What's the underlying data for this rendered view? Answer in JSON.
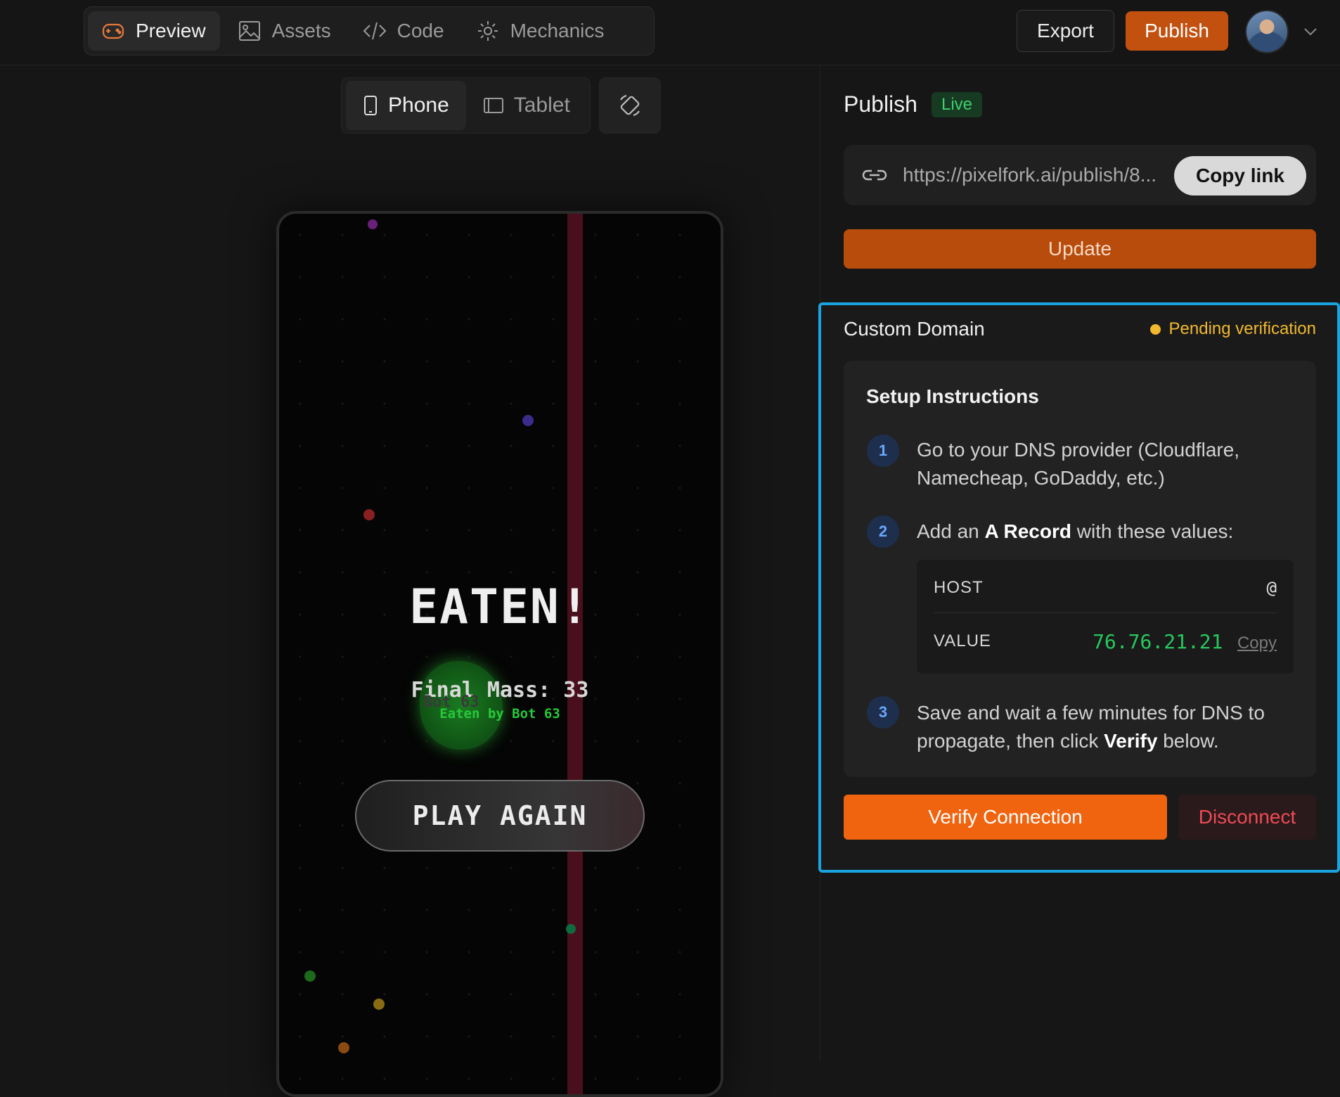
{
  "header": {
    "tabs": [
      {
        "label": "Preview",
        "icon": "gamepad-icon",
        "active": true
      },
      {
        "label": "Assets",
        "icon": "image-icon",
        "active": false
      },
      {
        "label": "Code",
        "icon": "code-icon",
        "active": false
      },
      {
        "label": "Mechanics",
        "icon": "gear-icon",
        "active": false
      }
    ],
    "export_label": "Export",
    "publish_label": "Publish",
    "accent_color": "#c2510f"
  },
  "preview": {
    "devices": [
      {
        "label": "Phone",
        "icon": "phone-icon",
        "active": true
      },
      {
        "label": "Tablet",
        "icon": "tablet-icon",
        "active": false
      }
    ],
    "rotate_icon": "rotate-icon",
    "game": {
      "title": "EATEN!",
      "final_mass": "Final Mass: 33",
      "bot_label": "Bot 63",
      "eaten_by": "Eaten by Bot 63",
      "play_again": "PLAY AGAIN"
    }
  },
  "publish": {
    "title": "Publish",
    "status_badge": "Live",
    "url": "https://pixelfork.ai/publish/8...",
    "copy_link_label": "Copy link",
    "update_label": "Update"
  },
  "custom_domain": {
    "title": "Custom Domain",
    "status": "Pending verification",
    "status_color": "#f1b92e",
    "setup_title": "Setup Instructions",
    "steps": [
      {
        "num": "1",
        "text": "Go to your DNS provider (Cloudflare, Namecheap, GoDaddy, etc.)"
      },
      {
        "num": "2",
        "pre": "Add an ",
        "bold": "A Record",
        "post": " with these values:"
      },
      {
        "num": "3",
        "pre": "Save and wait a few minutes for DNS to propagate, then click ",
        "bold": "Verify",
        "post": " below."
      }
    ],
    "record": {
      "host_label": "HOST",
      "host_value": "@",
      "value_label": "VALUE",
      "value": "76.76.21.21",
      "copy_label": "Copy"
    },
    "verify_label": "Verify Connection",
    "disconnect_label": "Disconnect"
  }
}
